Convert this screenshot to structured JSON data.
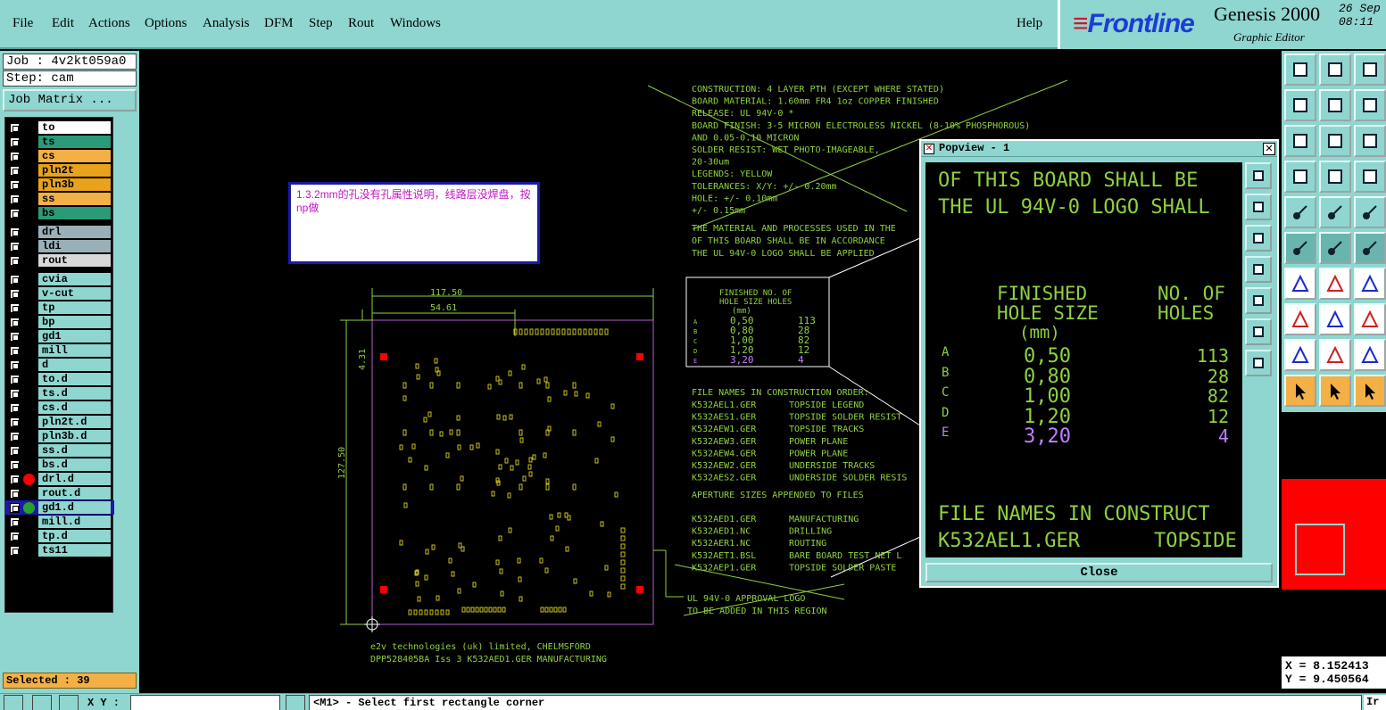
{
  "menu": {
    "items": [
      {
        "label": "File",
        "key": "F"
      },
      {
        "label": "Edit",
        "key": "E"
      },
      {
        "label": "Actions",
        "key": "A"
      },
      {
        "label": "Options",
        "key": "O"
      },
      {
        "label": "Analysis",
        "key": ""
      },
      {
        "label": "DFM",
        "key": ""
      },
      {
        "label": "Step",
        "key": "S"
      },
      {
        "label": "Rout",
        "key": "R"
      },
      {
        "label": "Windows",
        "key": "W"
      }
    ],
    "help": "Help"
  },
  "brand": {
    "logo": "Frontline",
    "title": "Genesis 2000",
    "subtitle": "Graphic Editor",
    "date_line1": "26 Sep",
    "date_line2": "08:11"
  },
  "left_panel": {
    "job": "Job : 4v2kt059a0",
    "step": "Step: cam",
    "job_matrix": "Job Matrix ...",
    "selected": "Selected : 39",
    "layers": [
      {
        "name": "to",
        "color": "#ffffff",
        "dot": "",
        "group": 1
      },
      {
        "name": "ts",
        "color": "#2a9a78",
        "dot": "",
        "group": 1
      },
      {
        "name": "cs",
        "color": "#f3b046",
        "dot": "",
        "group": 1
      },
      {
        "name": "pln2t",
        "color": "#e8a21c",
        "dot": "",
        "group": 1
      },
      {
        "name": "pln3b",
        "color": "#e8a21c",
        "dot": "",
        "group": 1
      },
      {
        "name": "ss",
        "color": "#f3b046",
        "dot": "",
        "group": 1
      },
      {
        "name": "bs",
        "color": "#2a9a78",
        "dot": "",
        "group": 1
      },
      {
        "name": "drl",
        "color": "#9ab0b8",
        "dot": "",
        "group": 2
      },
      {
        "name": "ldi",
        "color": "#9ab0b8",
        "dot": "",
        "group": 2
      },
      {
        "name": "rout",
        "color": "#d8d8d8",
        "dot": "",
        "group": 2
      },
      {
        "name": "cvia",
        "color": "#8fd6d0",
        "dot": "",
        "group": 3
      },
      {
        "name": "v-cut",
        "color": "#8fd6d0",
        "dot": "",
        "group": 3
      },
      {
        "name": "tp",
        "color": "#8fd6d0",
        "dot": "",
        "group": 3
      },
      {
        "name": "bp",
        "color": "#8fd6d0",
        "dot": "",
        "group": 3
      },
      {
        "name": "gd1",
        "color": "#8fd6d0",
        "dot": "",
        "group": 3
      },
      {
        "name": "mill",
        "color": "#8fd6d0",
        "dot": "",
        "group": 3
      },
      {
        "name": "d",
        "color": "#8fd6d0",
        "dot": "",
        "group": 3
      },
      {
        "name": "to.d",
        "color": "#8fd6d0",
        "dot": "",
        "group": 3
      },
      {
        "name": "ts.d",
        "color": "#8fd6d0",
        "dot": "",
        "group": 3
      },
      {
        "name": "cs.d",
        "color": "#8fd6d0",
        "dot": "",
        "group": 3
      },
      {
        "name": "pln2t.d",
        "color": "#8fd6d0",
        "dot": "",
        "group": 3
      },
      {
        "name": "pln3b.d",
        "color": "#8fd6d0",
        "dot": "",
        "group": 3
      },
      {
        "name": "ss.d",
        "color": "#8fd6d0",
        "dot": "",
        "group": 3
      },
      {
        "name": "bs.d",
        "color": "#8fd6d0",
        "dot": "",
        "group": 3
      },
      {
        "name": "drl.d",
        "color": "#8fd6d0",
        "dot": "#ff0000",
        "group": 3
      },
      {
        "name": "rout.d",
        "color": "#8fd6d0",
        "dot": "",
        "group": 3
      },
      {
        "name": "gd1.d",
        "color": "#8fd6d0",
        "dot": "#2aa02a",
        "group": 3,
        "active": true
      },
      {
        "name": "mill.d",
        "color": "#8fd6d0",
        "dot": "",
        "group": 3
      },
      {
        "name": "tp.d",
        "color": "#8fd6d0",
        "dot": "",
        "group": 3
      },
      {
        "name": "ts11",
        "color": "#8fd6d0",
        "dot": "",
        "group": 3
      }
    ]
  },
  "canvas": {
    "note": "1.3.2mm的孔没有孔属性说明，线路层没焊盘，按np做",
    "construction_notes": [
      "CONSTRUCTION:   4 LAYER PTH (EXCEPT WHERE STATED)",
      "BOARD MATERIAL: 1.60mm FR4 1oz COPPER FINISHED",
      "RELEASE:        UL 94V-0 *",
      "BOARD FINISH:   3-5 MICRON ELECTROLESS NICKEL (8-10% PHOSPHOROUS)",
      "                AND 0.05-0.10 MICRON",
      "SOLDER RESIST:  WET PHOTO-IMAGEABLE,",
      "                20-30um",
      "LEGENDS:        YELLOW",
      "TOLERANCES:     X/Y:   +/- 0.20mm",
      "                HOLE:  +/- 0.10mm",
      "                       +/- 0.15mm"
    ],
    "material_notes": [
      "THE MATERIAL AND PROCESSES USED IN THE",
      "OF THIS BOARD SHALL BE IN ACCORDANCE",
      "THE UL 94V-0 LOGO SHALL BE APPLIED"
    ],
    "file_names_heading": "FILE NAMES IN CONSTRUCTION ORDER:",
    "file_names": [
      {
        "file": "K532AEL1.GER",
        "desc": "TOPSIDE LEGEND"
      },
      {
        "file": "K532AES1.GER",
        "desc": "TOPSIDE SOLDER RESIST"
      },
      {
        "file": "K532AEW1.GER",
        "desc": "TOPSIDE TRACKS"
      },
      {
        "file": "K532AEW3.GER",
        "desc": "POWER PLANE"
      },
      {
        "file": "K532AEW4.GER",
        "desc": "POWER PLANE"
      },
      {
        "file": "K532AEW2.GER",
        "desc": "UNDERSIDE TRACKS"
      },
      {
        "file": "K532AES2.GER",
        "desc": "UNDERSIDE SOLDER RESIS"
      }
    ],
    "aperture_note": "APERTURE SIZES APPENDED TO FILES",
    "mfg_files": [
      {
        "file": "K532AED1.GER",
        "desc": "MANUFACTURING"
      },
      {
        "file": "K532AED1.NC",
        "desc": "DRILLING"
      },
      {
        "file": "K532AER1.NC",
        "desc": "ROUTING"
      },
      {
        "file": "K532AET1.BSL",
        "desc": "BARE BOARD TEST NET L"
      },
      {
        "file": "K532AEP1.GER",
        "desc": "TOPSIDE SOLDER PASTE"
      }
    ],
    "ul_logo_note": [
      "UL 94V-0 APPROVAL LOGO",
      "TO BE ADDED IN THIS REGION"
    ],
    "hole_table": {
      "header1": "FINISHED   NO. OF",
      "header2": "HOLE SIZE  HOLES",
      "unit": "(mm)",
      "rows": [
        {
          "id": "A",
          "size": "0,50",
          "count": "113"
        },
        {
          "id": "B",
          "size": "0,80",
          "count": "28"
        },
        {
          "id": "C",
          "size": "1,00",
          "count": "82"
        },
        {
          "id": "D",
          "size": "1,20",
          "count": "12"
        },
        {
          "id": "E",
          "size": "3,20",
          "count": "4"
        }
      ]
    },
    "dims": {
      "width1": "117.50",
      "width2": "54.61",
      "height": "127.50",
      "offset": "4.31"
    },
    "footer1": "e2v technologies (uk) limited, CHELMSFORD",
    "footer2": "DPP528405BA Iss 3    K532AED1.GER    MANUFACTURING"
  },
  "popview": {
    "title": "Popview - 1",
    "line1": "OF THIS BOARD SHALL BE",
    "line2": "THE UL 94V-0 LOGO SHALL",
    "header1": "FINISHED",
    "header1b": "NO. OF",
    "header2": "HOLE SIZE",
    "header2b": "HOLES",
    "unit": "(mm)",
    "rows": [
      {
        "id": "A",
        "size": "0,50",
        "count": "113"
      },
      {
        "id": "B",
        "size": "0,80",
        "count": "28"
      },
      {
        "id": "C",
        "size": "1,00",
        "count": "82"
      },
      {
        "id": "D",
        "size": "1,20",
        "count": "12"
      },
      {
        "id": "E",
        "size": "3,20",
        "count": "4"
      }
    ],
    "footer1": "FILE NAMES IN CONSTRUCT",
    "footer2a": "K532AEL1.GER",
    "footer2b": "TOPSIDE",
    "close": "Close"
  },
  "coords": {
    "x": "X = 8.152413",
    "y": "Y = 9.450564"
  },
  "bottom": {
    "xy_label": "X Y :",
    "status": "<M1> - Select first rectangle corner",
    "right": "Ir"
  }
}
